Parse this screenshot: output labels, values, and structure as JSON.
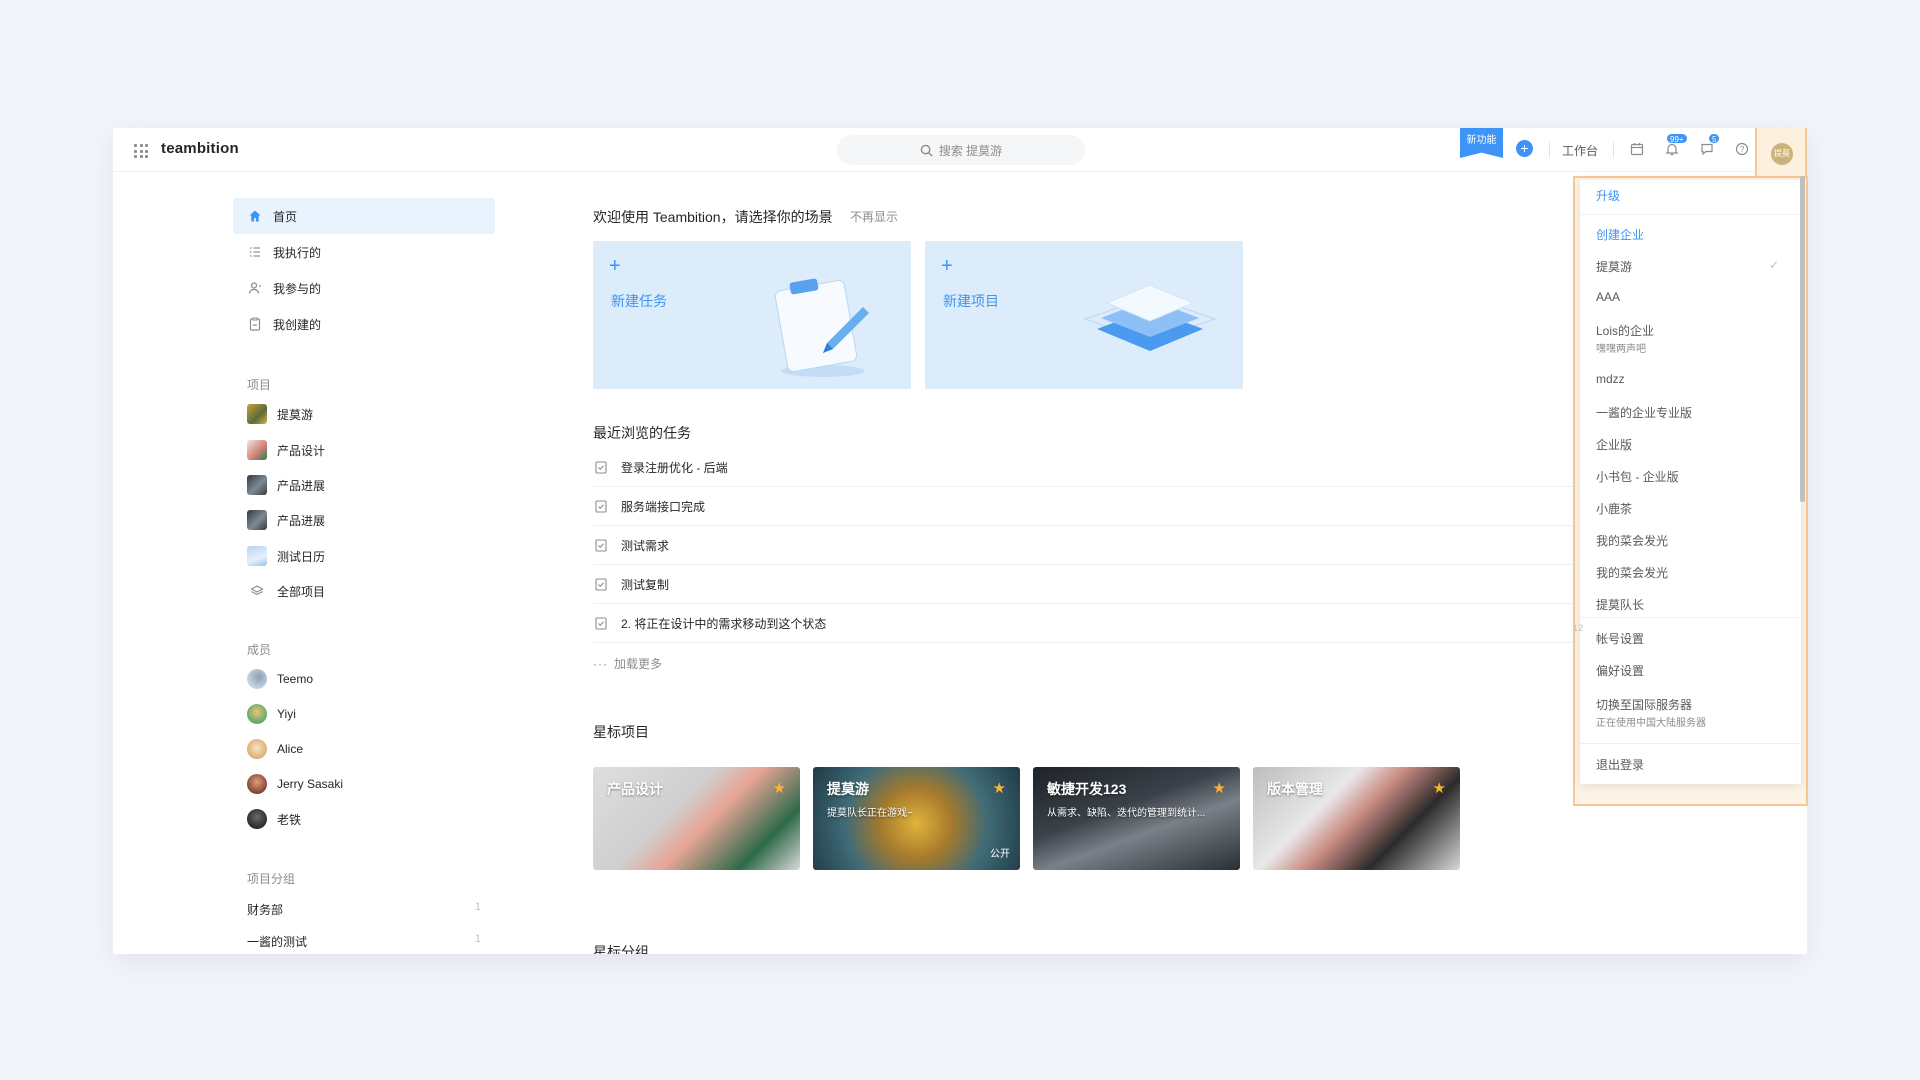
{
  "header": {
    "logo": "teambition",
    "search_placeholder": "搜索 提莫游",
    "new_feature": "新功能",
    "plus": "+",
    "workbench": "工作台",
    "notif_badge": "99+",
    "msg_badge": "5",
    "avatar_text": "提莫"
  },
  "sidebar": {
    "nav": [
      {
        "label": "首页",
        "icon": "home-icon"
      },
      {
        "label": "我执行的",
        "icon": "list-icon"
      },
      {
        "label": "我参与的",
        "icon": "user-icon"
      },
      {
        "label": "我创建的",
        "icon": "clipboard-icon"
      }
    ],
    "projects_title": "项目",
    "projects": [
      {
        "label": "提莫游"
      },
      {
        "label": "产品设计"
      },
      {
        "label": "产品进展"
      },
      {
        "label": "产品进展"
      },
      {
        "label": "测试日历"
      },
      {
        "label": "全部项目"
      }
    ],
    "members_title": "成员",
    "members": [
      {
        "label": "Teemo"
      },
      {
        "label": "Yiyi"
      },
      {
        "label": "Alice"
      },
      {
        "label": "Jerry Sasaki"
      },
      {
        "label": "老铁"
      }
    ],
    "groups_title": "项目分组",
    "groups": [
      {
        "label": "财务部",
        "count": "1"
      },
      {
        "label": "一酱的测试",
        "count": "1"
      }
    ]
  },
  "main": {
    "welcome": "欢迎使用 Teambition，请选择你的场景",
    "no_show": "不再显示",
    "card_task": "新建任务",
    "card_project": "新建项目",
    "card_plus": "+",
    "recent_title": "最近浏览的任务",
    "tasks": [
      "登录注册优化 - 后端",
      "服务端接口完成",
      "测试需求",
      "测试复制",
      "2. 将正在设计中的需求移动到这个状态"
    ],
    "load_more_dots": "···",
    "load_more": "加载更多",
    "starred_title": "星标项目",
    "starred": [
      {
        "name": "产品设计",
        "desc": "",
        "public": ""
      },
      {
        "name": "提莫游",
        "desc": "提莫队长正在游戏~",
        "public": "公开"
      },
      {
        "name": "敏捷开发123",
        "desc": "从需求、缺陷、迭代的管理到统计...",
        "public": ""
      },
      {
        "name": "版本管理",
        "desc": "",
        "public": ""
      }
    ],
    "star_glyph": "★",
    "starred_groups_title": "星标分组",
    "row_count_hint": "12"
  },
  "dropdown": {
    "upgrade": "升级",
    "create_org": "创建企业",
    "orgs": [
      {
        "label": "提莫游",
        "sub": "",
        "checked": "✓"
      },
      {
        "label": "AAA",
        "sub": ""
      },
      {
        "label": "Lois的企业",
        "sub": "嘿嘿两声吧"
      },
      {
        "label": "mdzz",
        "sub": ""
      },
      {
        "label": "一酱的企业专业版",
        "sub": ""
      },
      {
        "label": "企业版",
        "sub": ""
      },
      {
        "label": "小书包 - 企业版",
        "sub": ""
      },
      {
        "label": "小鹿茶",
        "sub": ""
      },
      {
        "label": "我的菜会发光",
        "sub": ""
      },
      {
        "label": "我的菜会发光",
        "sub": ""
      },
      {
        "label": "提莫队长",
        "sub": ""
      }
    ],
    "account_settings": "帐号设置",
    "preferences": "偏好设置",
    "switch_server": "切换至国际服务器",
    "switch_server_sub": "正在使用中国大陆服务器",
    "logout": "退出登录"
  },
  "colors": {
    "accent": "#3d94f6",
    "highlight_outline": "#f7c890",
    "active_nav_bg": "#e8f3fd",
    "card_bg": "#dcecfb",
    "star": "#f9b233"
  }
}
